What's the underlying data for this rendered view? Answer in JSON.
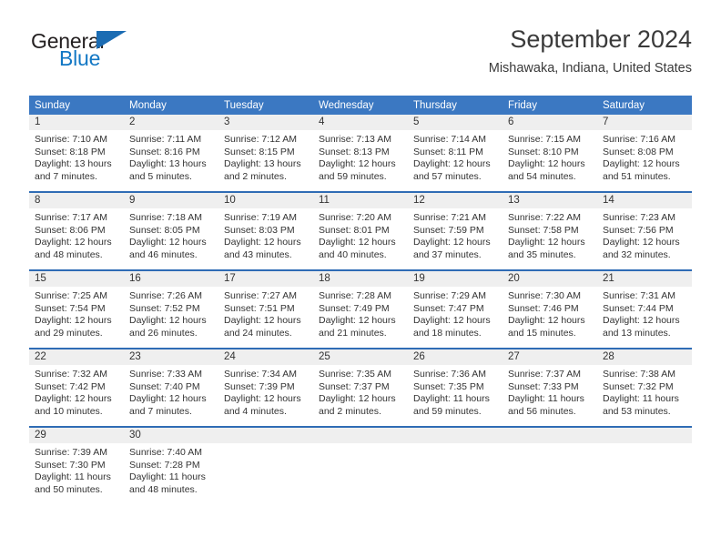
{
  "brand": {
    "name_part1": "General",
    "name_part2": "Blue",
    "logo_icon": "triangle-logo",
    "colors": {
      "dark": "#231f20",
      "blue": "#1277c4",
      "triangle": "#1b6cb3"
    }
  },
  "header": {
    "month_title": "September 2024",
    "location": "Mishawaka, Indiana, United States"
  },
  "theme": {
    "header_blue": "#3b78c2",
    "row_divider_blue": "#2f6cb5",
    "daynum_band_gray": "#efefef",
    "text": "#333333"
  },
  "weekdays": [
    "Sunday",
    "Monday",
    "Tuesday",
    "Wednesday",
    "Thursday",
    "Friday",
    "Saturday"
  ],
  "weeks": [
    [
      {
        "day": "1",
        "sunrise": "Sunrise: 7:10 AM",
        "sunset": "Sunset: 8:18 PM",
        "daylight1": "Daylight: 13 hours",
        "daylight2": "and 7 minutes."
      },
      {
        "day": "2",
        "sunrise": "Sunrise: 7:11 AM",
        "sunset": "Sunset: 8:16 PM",
        "daylight1": "Daylight: 13 hours",
        "daylight2": "and 5 minutes."
      },
      {
        "day": "3",
        "sunrise": "Sunrise: 7:12 AM",
        "sunset": "Sunset: 8:15 PM",
        "daylight1": "Daylight: 13 hours",
        "daylight2": "and 2 minutes."
      },
      {
        "day": "4",
        "sunrise": "Sunrise: 7:13 AM",
        "sunset": "Sunset: 8:13 PM",
        "daylight1": "Daylight: 12 hours",
        "daylight2": "and 59 minutes."
      },
      {
        "day": "5",
        "sunrise": "Sunrise: 7:14 AM",
        "sunset": "Sunset: 8:11 PM",
        "daylight1": "Daylight: 12 hours",
        "daylight2": "and 57 minutes."
      },
      {
        "day": "6",
        "sunrise": "Sunrise: 7:15 AM",
        "sunset": "Sunset: 8:10 PM",
        "daylight1": "Daylight: 12 hours",
        "daylight2": "and 54 minutes."
      },
      {
        "day": "7",
        "sunrise": "Sunrise: 7:16 AM",
        "sunset": "Sunset: 8:08 PM",
        "daylight1": "Daylight: 12 hours",
        "daylight2": "and 51 minutes."
      }
    ],
    [
      {
        "day": "8",
        "sunrise": "Sunrise: 7:17 AM",
        "sunset": "Sunset: 8:06 PM",
        "daylight1": "Daylight: 12 hours",
        "daylight2": "and 48 minutes."
      },
      {
        "day": "9",
        "sunrise": "Sunrise: 7:18 AM",
        "sunset": "Sunset: 8:05 PM",
        "daylight1": "Daylight: 12 hours",
        "daylight2": "and 46 minutes."
      },
      {
        "day": "10",
        "sunrise": "Sunrise: 7:19 AM",
        "sunset": "Sunset: 8:03 PM",
        "daylight1": "Daylight: 12 hours",
        "daylight2": "and 43 minutes."
      },
      {
        "day": "11",
        "sunrise": "Sunrise: 7:20 AM",
        "sunset": "Sunset: 8:01 PM",
        "daylight1": "Daylight: 12 hours",
        "daylight2": "and 40 minutes."
      },
      {
        "day": "12",
        "sunrise": "Sunrise: 7:21 AM",
        "sunset": "Sunset: 7:59 PM",
        "daylight1": "Daylight: 12 hours",
        "daylight2": "and 37 minutes."
      },
      {
        "day": "13",
        "sunrise": "Sunrise: 7:22 AM",
        "sunset": "Sunset: 7:58 PM",
        "daylight1": "Daylight: 12 hours",
        "daylight2": "and 35 minutes."
      },
      {
        "day": "14",
        "sunrise": "Sunrise: 7:23 AM",
        "sunset": "Sunset: 7:56 PM",
        "daylight1": "Daylight: 12 hours",
        "daylight2": "and 32 minutes."
      }
    ],
    [
      {
        "day": "15",
        "sunrise": "Sunrise: 7:25 AM",
        "sunset": "Sunset: 7:54 PM",
        "daylight1": "Daylight: 12 hours",
        "daylight2": "and 29 minutes."
      },
      {
        "day": "16",
        "sunrise": "Sunrise: 7:26 AM",
        "sunset": "Sunset: 7:52 PM",
        "daylight1": "Daylight: 12 hours",
        "daylight2": "and 26 minutes."
      },
      {
        "day": "17",
        "sunrise": "Sunrise: 7:27 AM",
        "sunset": "Sunset: 7:51 PM",
        "daylight1": "Daylight: 12 hours",
        "daylight2": "and 24 minutes."
      },
      {
        "day": "18",
        "sunrise": "Sunrise: 7:28 AM",
        "sunset": "Sunset: 7:49 PM",
        "daylight1": "Daylight: 12 hours",
        "daylight2": "and 21 minutes."
      },
      {
        "day": "19",
        "sunrise": "Sunrise: 7:29 AM",
        "sunset": "Sunset: 7:47 PM",
        "daylight1": "Daylight: 12 hours",
        "daylight2": "and 18 minutes."
      },
      {
        "day": "20",
        "sunrise": "Sunrise: 7:30 AM",
        "sunset": "Sunset: 7:46 PM",
        "daylight1": "Daylight: 12 hours",
        "daylight2": "and 15 minutes."
      },
      {
        "day": "21",
        "sunrise": "Sunrise: 7:31 AM",
        "sunset": "Sunset: 7:44 PM",
        "daylight1": "Daylight: 12 hours",
        "daylight2": "and 13 minutes."
      }
    ],
    [
      {
        "day": "22",
        "sunrise": "Sunrise: 7:32 AM",
        "sunset": "Sunset: 7:42 PM",
        "daylight1": "Daylight: 12 hours",
        "daylight2": "and 10 minutes."
      },
      {
        "day": "23",
        "sunrise": "Sunrise: 7:33 AM",
        "sunset": "Sunset: 7:40 PM",
        "daylight1": "Daylight: 12 hours",
        "daylight2": "and 7 minutes."
      },
      {
        "day": "24",
        "sunrise": "Sunrise: 7:34 AM",
        "sunset": "Sunset: 7:39 PM",
        "daylight1": "Daylight: 12 hours",
        "daylight2": "and 4 minutes."
      },
      {
        "day": "25",
        "sunrise": "Sunrise: 7:35 AM",
        "sunset": "Sunset: 7:37 PM",
        "daylight1": "Daylight: 12 hours",
        "daylight2": "and 2 minutes."
      },
      {
        "day": "26",
        "sunrise": "Sunrise: 7:36 AM",
        "sunset": "Sunset: 7:35 PM",
        "daylight1": "Daylight: 11 hours",
        "daylight2": "and 59 minutes."
      },
      {
        "day": "27",
        "sunrise": "Sunrise: 7:37 AM",
        "sunset": "Sunset: 7:33 PM",
        "daylight1": "Daylight: 11 hours",
        "daylight2": "and 56 minutes."
      },
      {
        "day": "28",
        "sunrise": "Sunrise: 7:38 AM",
        "sunset": "Sunset: 7:32 PM",
        "daylight1": "Daylight: 11 hours",
        "daylight2": "and 53 minutes."
      }
    ],
    [
      {
        "day": "29",
        "sunrise": "Sunrise: 7:39 AM",
        "sunset": "Sunset: 7:30 PM",
        "daylight1": "Daylight: 11 hours",
        "daylight2": "and 50 minutes."
      },
      {
        "day": "30",
        "sunrise": "Sunrise: 7:40 AM",
        "sunset": "Sunset: 7:28 PM",
        "daylight1": "Daylight: 11 hours",
        "daylight2": "and 48 minutes."
      },
      {
        "day": "",
        "sunrise": "",
        "sunset": "",
        "daylight1": "",
        "daylight2": ""
      },
      {
        "day": "",
        "sunrise": "",
        "sunset": "",
        "daylight1": "",
        "daylight2": ""
      },
      {
        "day": "",
        "sunrise": "",
        "sunset": "",
        "daylight1": "",
        "daylight2": ""
      },
      {
        "day": "",
        "sunrise": "",
        "sunset": "",
        "daylight1": "",
        "daylight2": ""
      },
      {
        "day": "",
        "sunrise": "",
        "sunset": "",
        "daylight1": "",
        "daylight2": ""
      }
    ]
  ]
}
